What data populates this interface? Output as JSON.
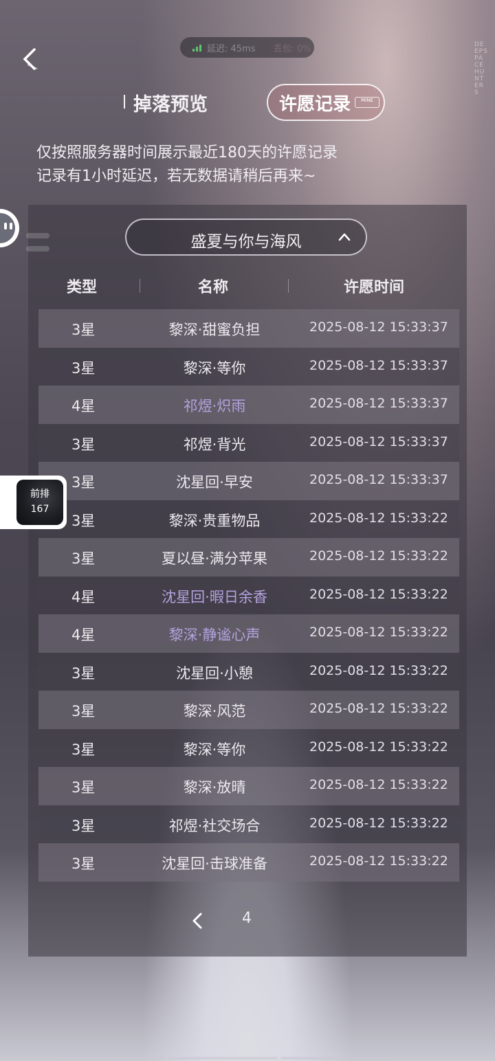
{
  "status": {
    "latency": "延迟: 45ms",
    "extra": "丢包: 0%"
  },
  "brand": "DEEPSPACE HUNTERS",
  "tabs": {
    "drop_preview": "掉落预览",
    "wish_record": "许愿记录",
    "wish_badge": "MINE"
  },
  "notice": {
    "line1": "仅按照服务器时间展示最近180天的许愿记录",
    "line2": "记录有1小时延迟，若无数据请稍后再来~"
  },
  "pool": {
    "selected": "盛夏与你与海风"
  },
  "table": {
    "headers": {
      "type": "类型",
      "name": "名称",
      "time": "许愿时间"
    },
    "rows": [
      {
        "type": "3星",
        "name": "黎深·甜蜜负担",
        "time": "2025-08-12 15:33:37"
      },
      {
        "type": "3星",
        "name": "黎深·等你",
        "time": "2025-08-12 15:33:37"
      },
      {
        "type": "4星",
        "name": "祁煜·炽雨",
        "time": "2025-08-12 15:33:37"
      },
      {
        "type": "3星",
        "name": "祁煜·背光",
        "time": "2025-08-12 15:33:37"
      },
      {
        "type": "3星",
        "name": "沈星回·早安",
        "time": "2025-08-12 15:33:37"
      },
      {
        "type": "3星",
        "name": "黎深·贵重物品",
        "time": "2025-08-12 15:33:22"
      },
      {
        "type": "3星",
        "name": "夏以昼·满分苹果",
        "time": "2025-08-12 15:33:22"
      },
      {
        "type": "4星",
        "name": "沈星回·暇日余香",
        "time": "2025-08-12 15:33:22"
      },
      {
        "type": "4星",
        "name": "黎深·静谧心声",
        "time": "2025-08-12 15:33:22"
      },
      {
        "type": "3星",
        "name": "沈星回·小憩",
        "time": "2025-08-12 15:33:22"
      },
      {
        "type": "3星",
        "name": "黎深·风范",
        "time": "2025-08-12 15:33:22"
      },
      {
        "type": "3星",
        "name": "黎深·等你",
        "time": "2025-08-12 15:33:22"
      },
      {
        "type": "3星",
        "name": "黎深·放晴",
        "time": "2025-08-12 15:33:22"
      },
      {
        "type": "3星",
        "name": "祁煜·社交场合",
        "time": "2025-08-12 15:33:22"
      },
      {
        "type": "3星",
        "name": "沈星回·击球准备",
        "time": "2025-08-12 15:33:22"
      }
    ]
  },
  "pager": {
    "page": "4"
  },
  "float_card": {
    "line1": "前排",
    "line2": "167"
  },
  "colors": {
    "four_star": "#b4a2de",
    "signal": "#5fc56a"
  },
  "icons": {
    "back": "chevron-left-icon",
    "pool_toggle": "chevron-up-icon",
    "prev_page": "chevron-left-icon",
    "chat": "chat-bubble-icon",
    "signal": "signal-bars-icon"
  }
}
